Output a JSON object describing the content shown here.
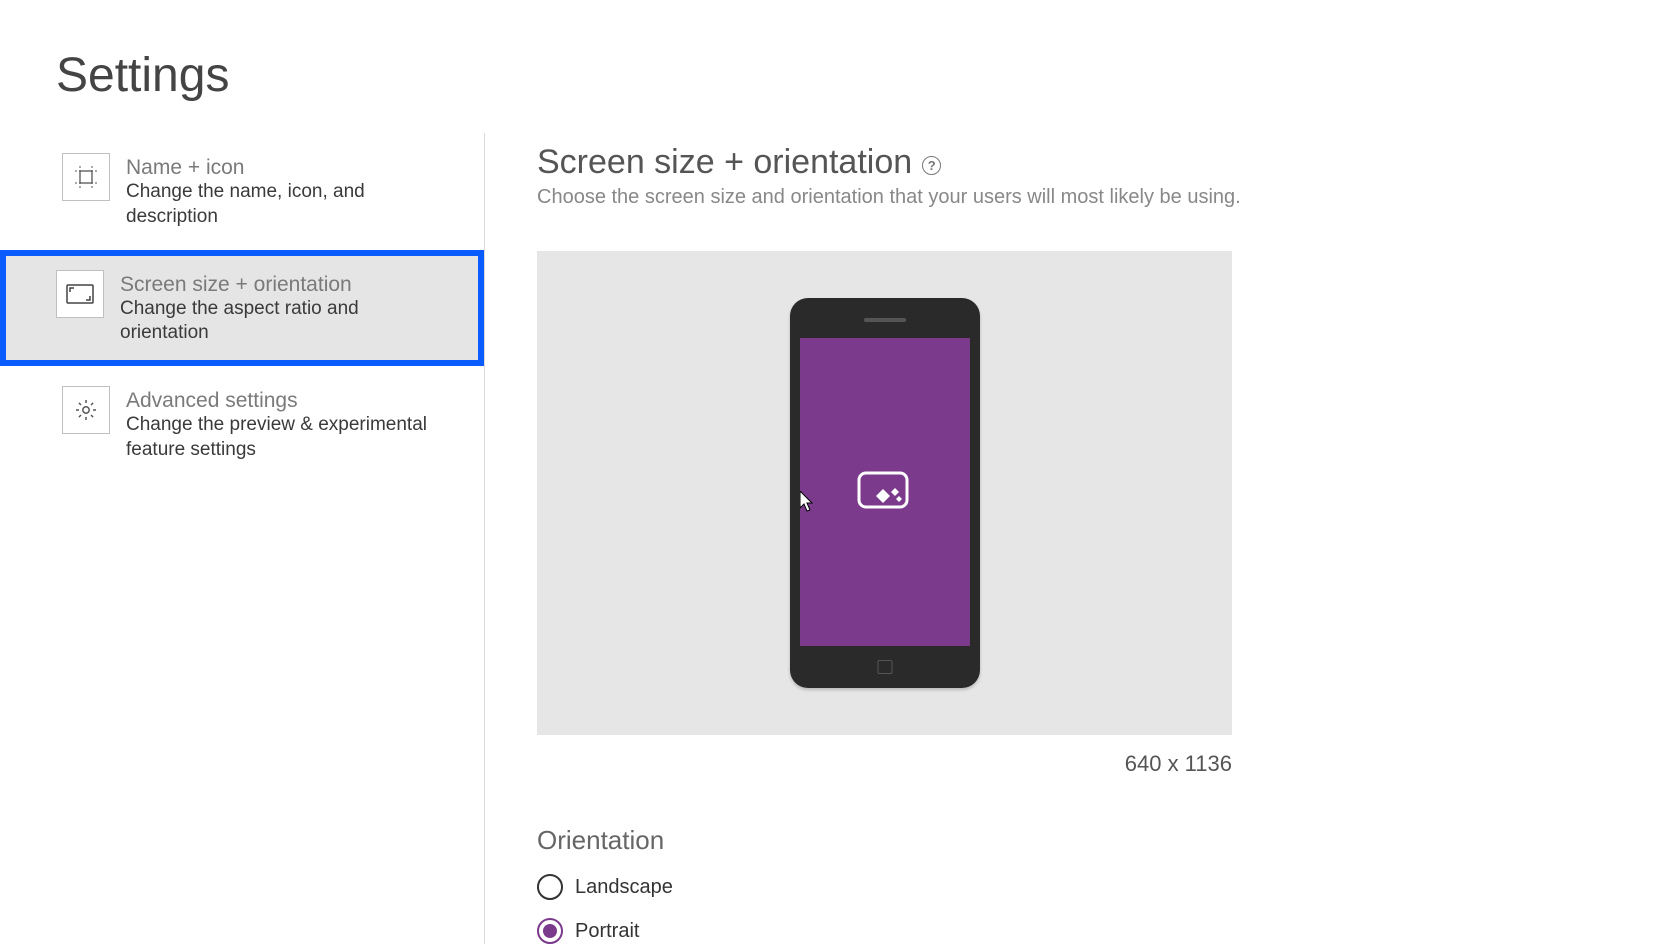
{
  "pageTitle": "Settings",
  "sidebar": {
    "items": [
      {
        "title": "Name + icon",
        "desc": "Change the name, icon, and description"
      },
      {
        "title": "Screen size + orientation",
        "desc": "Change the aspect ratio and orientation"
      },
      {
        "title": "Advanced settings",
        "desc": "Change the preview & experimental feature settings"
      }
    ],
    "selectedIndex": 1
  },
  "panel": {
    "heading": "Screen size + orientation",
    "helpGlyph": "?",
    "subheading": "Choose the screen size and orientation that your users will most likely be using.",
    "resolution": "640 x 1136",
    "orientationLabel": "Orientation",
    "options": [
      {
        "label": "Landscape",
        "selected": false
      },
      {
        "label": "Portrait",
        "selected": true
      }
    ]
  },
  "colors": {
    "accent": "#7b3a8c",
    "highlight": "#0b5cff"
  }
}
